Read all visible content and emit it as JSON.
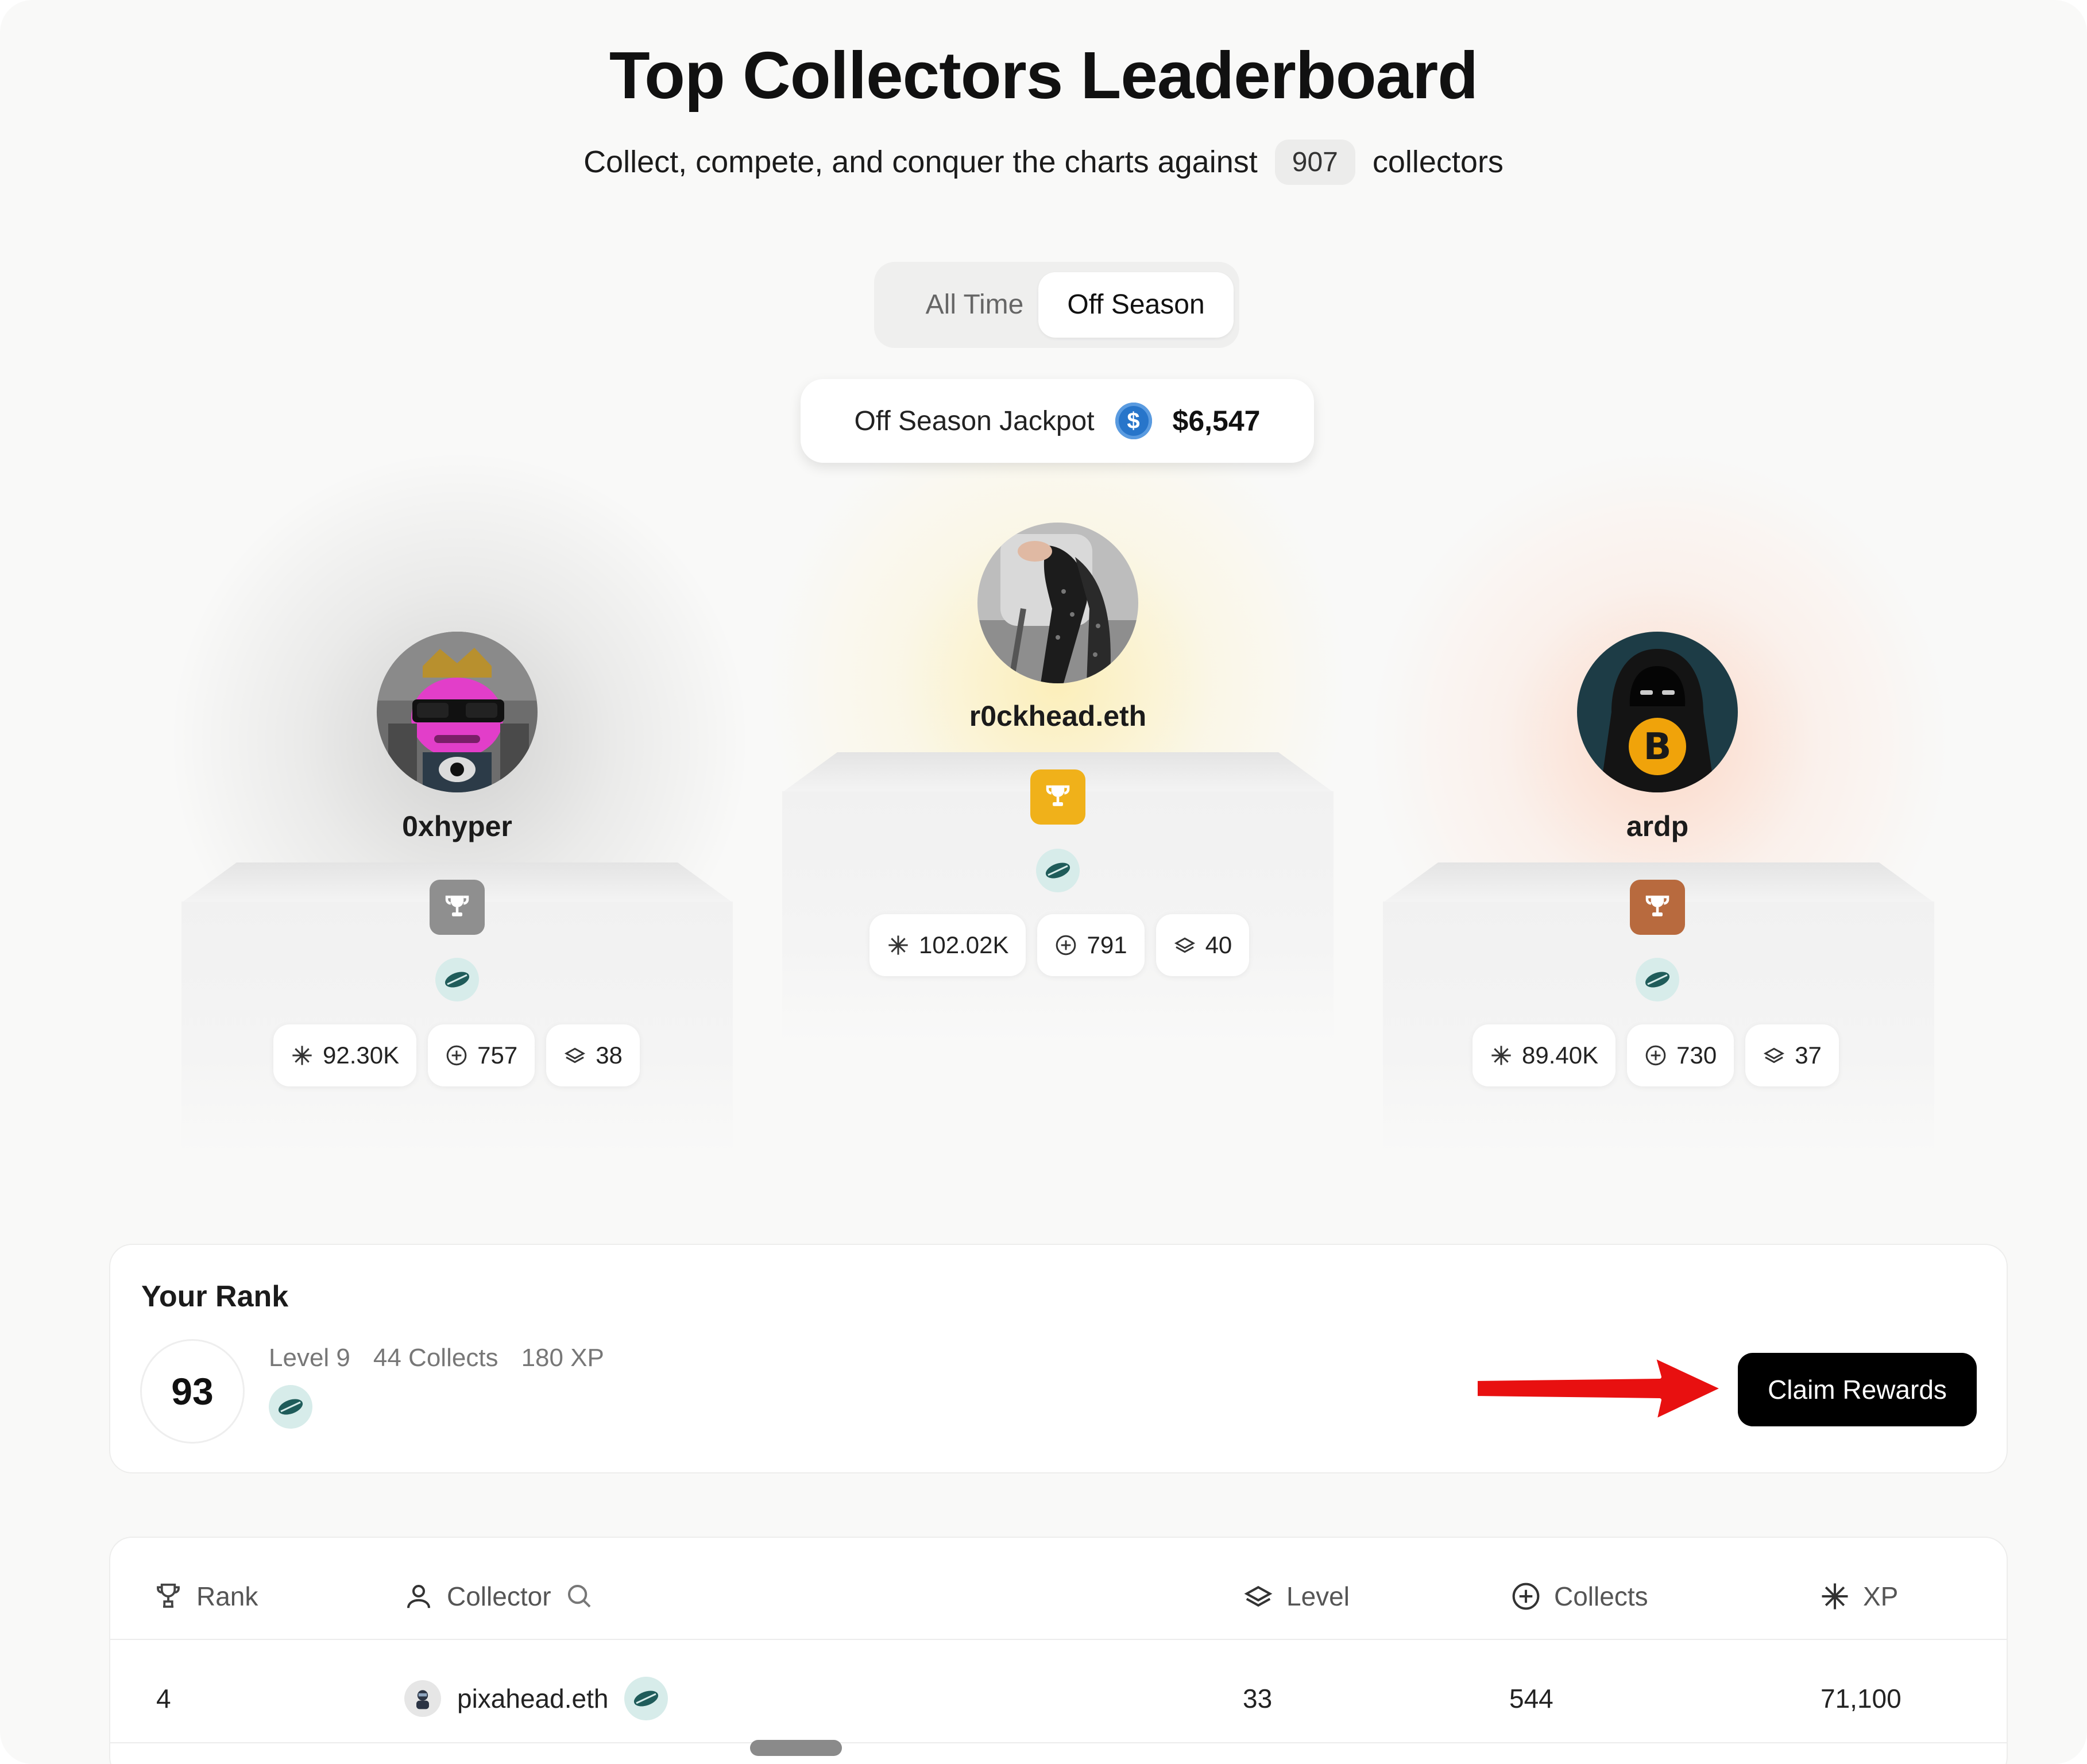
{
  "header": {
    "title": "Top Collectors Leaderboard",
    "subtitle_before": "Collect, compete, and conquer the charts against",
    "collector_count": "907",
    "subtitle_after": "collectors"
  },
  "tabs": {
    "items": [
      {
        "label": "All Time",
        "active": false
      },
      {
        "label": "Off Season",
        "active": true
      }
    ]
  },
  "jackpot": {
    "label": "Off Season Jackpot",
    "coin_icon": "usdc-coin-icon",
    "amount": "$6,547"
  },
  "podium": [
    {
      "place": 2,
      "name": "0xhyper",
      "trophy_color": "#8f8f8f",
      "stats": {
        "xp": "92.30K",
        "collects": "757",
        "level": "38"
      }
    },
    {
      "place": 1,
      "name": "r0ckhead.eth",
      "trophy_color": "#f0b11a",
      "stats": {
        "xp": "102.02K",
        "collects": "791",
        "level": "40"
      }
    },
    {
      "place": 3,
      "name": "ardp",
      "trophy_color": "#b86a3e",
      "stats": {
        "xp": "89.40K",
        "collects": "730",
        "level": "37"
      }
    }
  ],
  "your_rank": {
    "title": "Your Rank",
    "rank": "93",
    "level": "Level 9",
    "collects": "44 Collects",
    "xp": "180 XP",
    "claim_label": "Claim Rewards"
  },
  "table": {
    "columns": [
      "Rank",
      "Collector",
      "Level",
      "Collects",
      "XP"
    ],
    "rows": [
      {
        "rank": "4",
        "collector": "pixahead.eth",
        "level": "33",
        "collects": "544",
        "xp": "71,100"
      }
    ]
  },
  "colors": {
    "accent_black": "#000000",
    "gold": "#f0b11a",
    "silver": "#8f8f8f",
    "bronze": "#b86a3e",
    "annotation_arrow": "#e81010",
    "badge_teal": "#1f5c5a"
  }
}
